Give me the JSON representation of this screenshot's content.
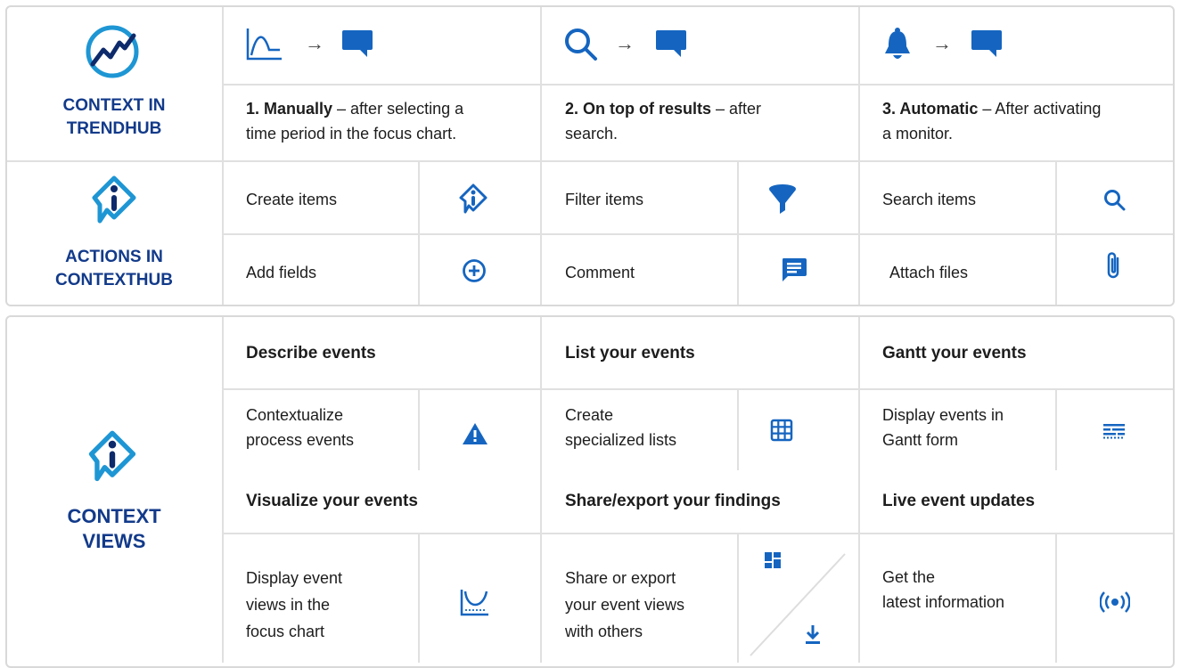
{
  "colors": {
    "brand": "#1565c0",
    "navy": "#0d2a6b",
    "border": "#d9d9d9"
  },
  "top": {
    "context_label_line1": "CONTEXT IN",
    "context_label_line2": "TRENDHUB",
    "actions_label_line1": "ACTIONS IN",
    "actions_label_line2": "CONTEXTHUB",
    "arrow": "→",
    "ways": [
      {
        "title": "1. Manually",
        "desc_line1": " – after selecting a",
        "desc_line2": "time period in the focus chart.",
        "icon": "trend-chart-icon"
      },
      {
        "title": "2. On top of results",
        "desc_line1": " – after",
        "desc_line2": "search.",
        "icon": "search-icon"
      },
      {
        "title": "3. Automatic",
        "desc_line1": " – After activating",
        "desc_line2": "a monitor.",
        "icon": "bell-icon"
      }
    ],
    "actions": [
      {
        "label": "Create items",
        "icon": "contexthub-logo-icon"
      },
      {
        "label": "Filter items",
        "icon": "filter-icon"
      },
      {
        "label": "Search items",
        "icon": "search-icon"
      },
      {
        "label": "Add fields",
        "icon": "add-circle-icon"
      },
      {
        "label": "Comment",
        "icon": "comment-icon"
      },
      {
        "label": "Attach files",
        "icon": "paperclip-icon"
      }
    ]
  },
  "bottom": {
    "label_line1": "CONTEXT",
    "label_line2": "VIEWS",
    "views": [
      {
        "title": "Describe events",
        "line1": "Contextualize",
        "line2": "process events",
        "icon": "warning-icon"
      },
      {
        "title": "List your events",
        "line1": "Create",
        "line2": "specialized lists",
        "icon": "grid-icon"
      },
      {
        "title": "Gantt your events",
        "line1": "Display events in",
        "line2": "Gantt form",
        "icon": "gantt-icon"
      },
      {
        "title": "Visualize your events",
        "line1": "Display event",
        "line2": "views in the",
        "line3": "focus chart",
        "icon": "focus-chart-icon"
      },
      {
        "title": "Share/export your findings",
        "line1": "Share or export",
        "line2": "your event views",
        "line3": "with others",
        "icon": "share-export-icon"
      },
      {
        "title": "Live event updates",
        "line1": "Get the",
        "line2": "latest information",
        "icon": "live-broadcast-icon"
      }
    ]
  }
}
